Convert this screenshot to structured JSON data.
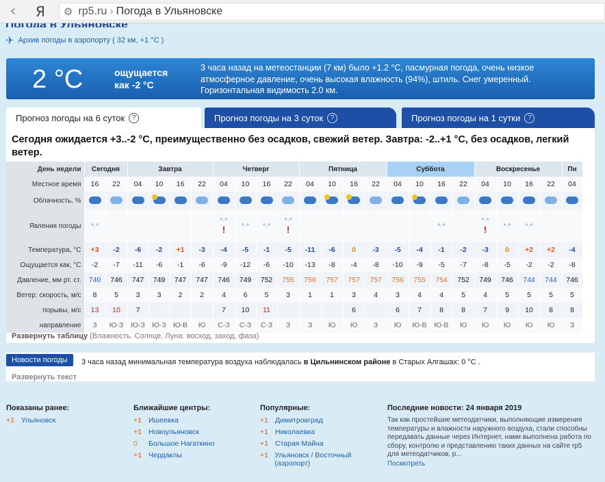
{
  "browser": {
    "back_icon": "‹",
    "ya_icon": "Я",
    "tool_icon": "⚙",
    "domain": "rp5.ru",
    "separator": "›",
    "page_title": "Погода в Ульяновске"
  },
  "header": {
    "cut_title": "Погода в Ульяновске",
    "archive_link": "Архив погоды в аэропорту ( 32 км, +1 °C )"
  },
  "now": {
    "temp": "2 °C",
    "feels_line1": "ощущается",
    "feels_line2": "как -2 °C",
    "description": "3 часа назад на метеостанции (7 км) было +1.2 °C, пасмурная погода, очень низкое атмосферное давление, очень высокая влажность (94%), штиль. Снег умеренный. Горизонтальная видимость 2.0 км."
  },
  "tabs": [
    {
      "label": "Прогноз погоды на 6 суток"
    },
    {
      "label": "Прогноз погоды на 3 суток"
    },
    {
      "label": "Прогноз погоды на 1 сутки"
    }
  ],
  "summary": "Сегодня ожидается +3..-2 °C, преимущественно без осадков, свежий ветер. Завтра: -2..+1 °C, без осадков, легкий ветер.",
  "table": {
    "labels": {
      "day": "День недели",
      "time": "Местное время",
      "cloud": "Облачность, %",
      "phen": "Явления погоды",
      "temp": "Температура, °C",
      "feels": "Ощущается как, °C",
      "press": "Давление, мм рт. ст.",
      "wind": "Ветер: скорость, м/с",
      "gust": "порывы, м/с",
      "dir": "направление"
    },
    "days": [
      {
        "name": "Сегодня",
        "span": 2
      },
      {
        "name": "Завтра",
        "span": 4
      },
      {
        "name": "Четверг",
        "span": 4
      },
      {
        "name": "Пятница",
        "span": 4
      },
      {
        "name": "Суббота",
        "span": 4
      },
      {
        "name": "Воскресенье",
        "span": 4
      },
      {
        "name": "Пн",
        "span": 1
      }
    ],
    "times": [
      "16",
      "22",
      "04",
      "10",
      "16",
      "22",
      "04",
      "10",
      "16",
      "22",
      "04",
      "10",
      "16",
      "22",
      "04",
      "10",
      "16",
      "22",
      "04",
      "10",
      "16",
      "22",
      "04"
    ],
    "temps": [
      "+3",
      "-2",
      "-6",
      "-2",
      "+1",
      "-3",
      "-4",
      "-5",
      "-1",
      "-5",
      "-11",
      "-6",
      "0",
      "-3",
      "-5",
      "-4",
      "-1",
      "-2",
      "-3",
      "0",
      "+2",
      "+2",
      "-4"
    ],
    "feels": [
      "-2",
      "-7",
      "-11",
      "-6",
      "-1",
      "-6",
      "-9",
      "-12",
      "-6",
      "-10",
      "-13",
      "-8",
      "-4",
      "-8",
      "-10",
      "-9",
      "-5",
      "-7",
      "-8",
      "-5",
      "-2",
      "-2",
      "-8"
    ],
    "pressure": [
      "740",
      "746",
      "747",
      "749",
      "747",
      "747",
      "746",
      "749",
      "752",
      "755",
      "756",
      "757",
      "757",
      "757",
      "756",
      "755",
      "754",
      "752",
      "749",
      "746",
      "744",
      "744",
      "746"
    ],
    "wind": [
      "8",
      "5",
      "3",
      "3",
      "2",
      "2",
      "4",
      "6",
      "5",
      "3",
      "1",
      "1",
      "3",
      "4",
      "3",
      "4",
      "4",
      "5",
      "4",
      "5",
      "5",
      "5",
      "5"
    ],
    "gusts": [
      "13",
      "10",
      "7",
      "",
      "",
      "",
      "7",
      "10",
      "11",
      "",
      "",
      "",
      "6",
      "",
      "6",
      "7",
      "8",
      "8",
      "7",
      "9",
      "10",
      "8",
      "8"
    ],
    "dirs": [
      "З",
      "Ю-З",
      "Ю-З",
      "Ю-З",
      "Ю-В",
      "Ю",
      "С-З",
      "С-З",
      "С-З",
      "З",
      "З",
      "Ю",
      "Ю",
      "З",
      "Ю",
      "Ю-В",
      "Ю-В",
      "Ю",
      "Ю",
      "Ю",
      "Ю",
      "Ю",
      "З"
    ],
    "expand": "Развернуть таблицу",
    "expand_note": "(Влажность. Солнце, Луна: восход, заход, фаза)"
  },
  "news": {
    "badge": "Новости погоды",
    "text_before": "3 часа назад минимальная температура воздуха наблюдалась ",
    "text_bold": "в Цильнинском районе",
    "text_after": " в Старых Алгашах: 0 °C .",
    "more": "Развернуть текст"
  },
  "footer": {
    "shown": {
      "title": "Показаны ранее:",
      "items": [
        {
          "d": "+1",
          "n": "Ульяновск"
        }
      ]
    },
    "near": {
      "title": "Ближайшие центры:",
      "items": [
        {
          "d": "+1",
          "n": "Ишеевка"
        },
        {
          "d": "+1",
          "n": "Новоульяновск"
        },
        {
          "d": "0",
          "n": "Большое Нагаткино"
        },
        {
          "d": "+1",
          "n": "Чердаклы"
        }
      ]
    },
    "popular": {
      "title": "Популярные:",
      "items": [
        {
          "d": "+1",
          "n": "Димитровград"
        },
        {
          "d": "+1",
          "n": "Николаевка"
        },
        {
          "d": "+1",
          "n": "Старая Майна"
        },
        {
          "d": "+1",
          "n": "Ульяновск / Восточный (аэропорт)"
        }
      ]
    },
    "latest": {
      "title": "Последние новости:",
      "date": "24 января 2019",
      "text": "Так как простейшие метеодатчики, выполняющие измерения температуры и влажности наружного воздуха, стали способны передавать данные через Интернет, нами выполнена работа по сбору, контролю и представлению таких данных на сайте rp5 для метеодатчиков, р...",
      "more": "Посмотреть"
    }
  },
  "colors": {
    "accent": "#1d4fa6",
    "banner": "#2d86d4",
    "warm": "#e0540f",
    "cold": "#2a4d8f"
  }
}
